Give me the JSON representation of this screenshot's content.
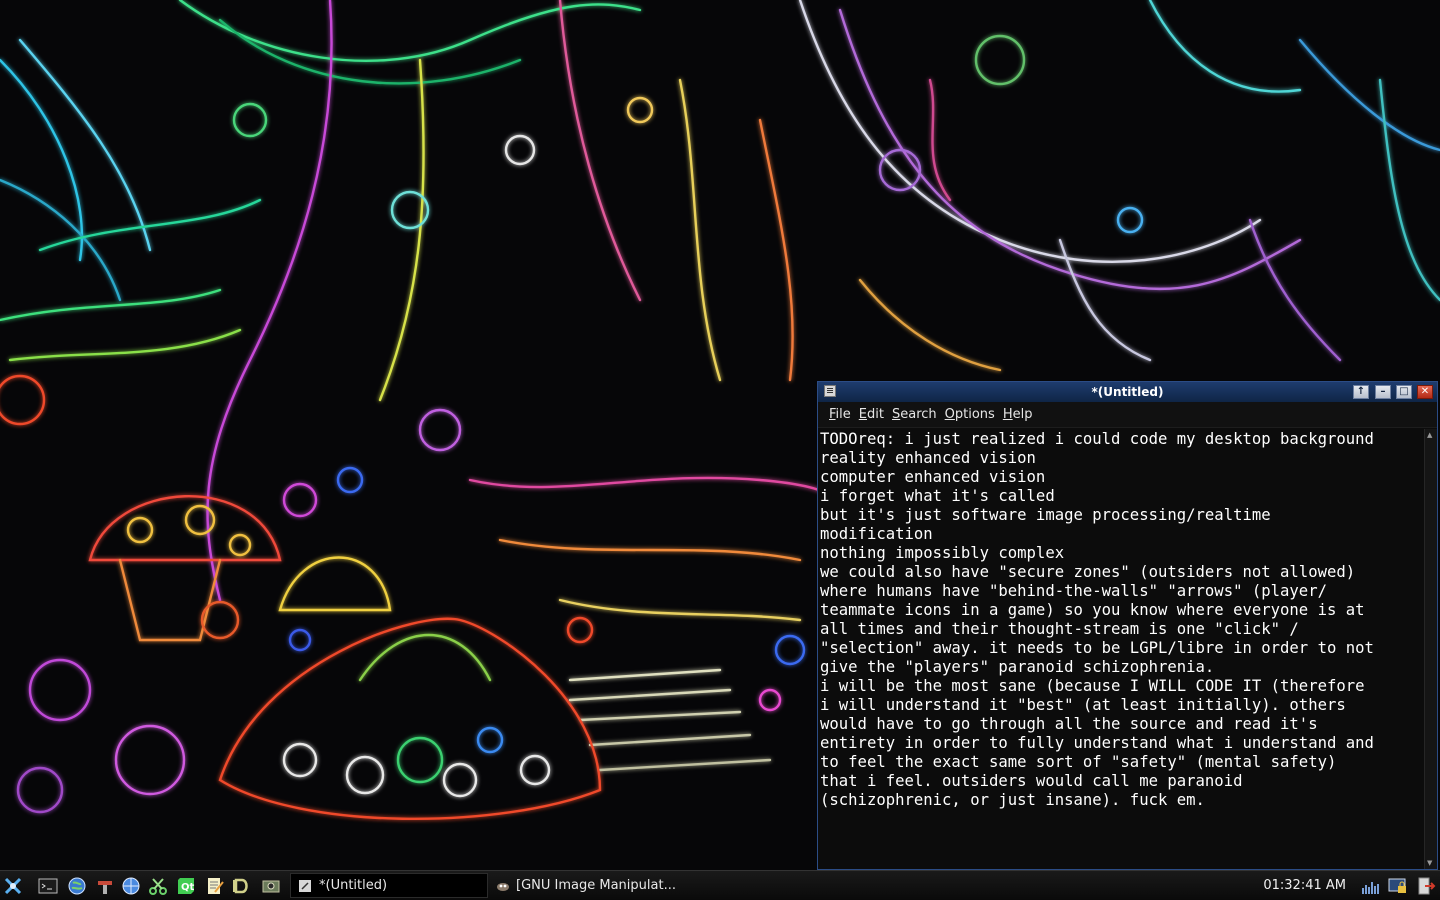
{
  "window": {
    "title": "*(Untitled)",
    "buttons": {
      "raise": "↑",
      "minimize": "–",
      "maximize": "□",
      "close": "✕"
    },
    "menu": [
      "File",
      "Edit",
      "Search",
      "Options",
      "Help"
    ],
    "text": "TODOreq: i just realized i could code my desktop background\nreality enhanced vision\ncomputer enhanced vision\ni forget what it's called\nbut it's just software image processing/realtime\nmodification\nnothing impossibly complex\nwe could also have \"secure zones\" (outsiders not allowed)\nwhere humans have \"behind-the-walls\" \"arrows\" (player/\nteammate icons in a game) so you know where everyone is at\nall times and their thought-stream is one \"click\" /\n\"selection\" away. it needs to be LGPL/libre in order to not\ngive the \"players\" paranoid schizophrenia.\ni will be the most sane (because I WILL CODE IT (therefore\ni will understand it \"best\" (at least initially). others\nwould have to go through all the source and read it's\nentirety in order to fully understand what i understand and\nto feel the exact same sort of \"safety\" (mental safety)\nthat i feel. outsiders would call me paranoid\n(schizophrenic, or just insane). fuck em."
  },
  "taskbar": {
    "launchers": [
      {
        "icon": "start-menu-icon"
      },
      {
        "icon": "terminal-icon"
      },
      {
        "icon": "globe-browser-icon"
      },
      {
        "icon": "toolbox-icon"
      },
      {
        "icon": "web-globe-icon"
      },
      {
        "icon": "scissors-icon"
      },
      {
        "icon": "qt-creator-icon"
      },
      {
        "icon": "text-editor-icon"
      },
      {
        "icon": "d-tool-icon"
      },
      {
        "icon": "screenshot-icon"
      }
    ],
    "tasks": [
      {
        "label": "*(Untitled)",
        "icon": "text-editor-task-icon",
        "active": true
      },
      {
        "label": "[GNU Image Manipulat...",
        "icon": "gimp-task-icon",
        "active": false
      }
    ],
    "clock": "01:32:41 AM",
    "tray": [
      {
        "icon": "network-activity-icon"
      },
      {
        "icon": "lock-screen-icon"
      },
      {
        "icon": "logout-icon"
      }
    ]
  },
  "colors": {
    "title_bar": "#1e3c6e",
    "editor_bg": "#0c0c0c",
    "editor_text": "#ffffff",
    "taskbar_bg": "#111111"
  }
}
